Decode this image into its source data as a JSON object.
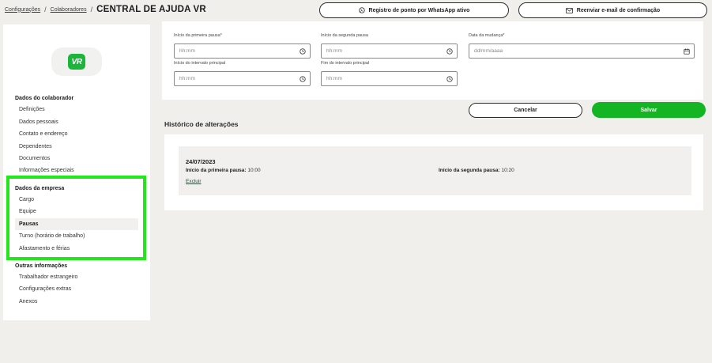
{
  "breadcrumb": {
    "items": [
      "Configurações",
      "Colaboradores"
    ],
    "separator": "/",
    "current": "CENTRAL DE AJUDA VR"
  },
  "header": {
    "whatsapp_label": "Registro de ponto por WhatsApp ativo",
    "whatsapp_icon": "whatsapp-icon",
    "resend_label": "Reenviar e-mail de confirmação",
    "resend_icon": "mail-icon"
  },
  "sidebar": {
    "logo_text": "VR",
    "logo_color": "#1cb53c",
    "sections": [
      {
        "title": "Dados do colaborador",
        "items": [
          "Definições",
          "Dados pessoais",
          "Contato e endereço",
          "Dependentes",
          "Documentos",
          "Informações especiais"
        ]
      },
      {
        "title": "Dados da empresa",
        "items": [
          "Cargo",
          "Equipe",
          "Pausas",
          "Turno (horário de trabalho)",
          "Afastamento e férias"
        ]
      },
      {
        "title": "Outras informações",
        "items": [
          "Trabalhador estrangeiro",
          "Configurações extras",
          "Anexos"
        ]
      }
    ],
    "active_item": "Pausas",
    "highlight_color": "#22e71c"
  },
  "form": {
    "fields": [
      {
        "label": "Início da primeira pausa*",
        "placeholder": "hh:mm",
        "icon": "clock-icon"
      },
      {
        "label": "Início da segunda pausa",
        "placeholder": "hh:mm",
        "icon": "clock-icon"
      },
      {
        "label": "Data da mudança*",
        "placeholder": "dd/mm/aaaa",
        "icon": "calendar-icon"
      },
      {
        "label": "Início do intervalo principal",
        "placeholder": "hh:mm",
        "icon": "clock-icon"
      },
      {
        "label": "Fim do intervalo principal",
        "placeholder": "hh:mm",
        "icon": "clock-icon"
      }
    ]
  },
  "actions": {
    "cancel_label": "Cancelar",
    "save_label": "Salvar",
    "save_color": "#13b522"
  },
  "history": {
    "title": "Histórico de alterações",
    "entries": [
      {
        "date": "24/07/2023",
        "first_label": "Início da primeira pausa:",
        "first_value": "10:00",
        "second_label": "Início da segunda pausa:",
        "second_value": "10:20",
        "delete_label": "Excluir"
      }
    ]
  }
}
